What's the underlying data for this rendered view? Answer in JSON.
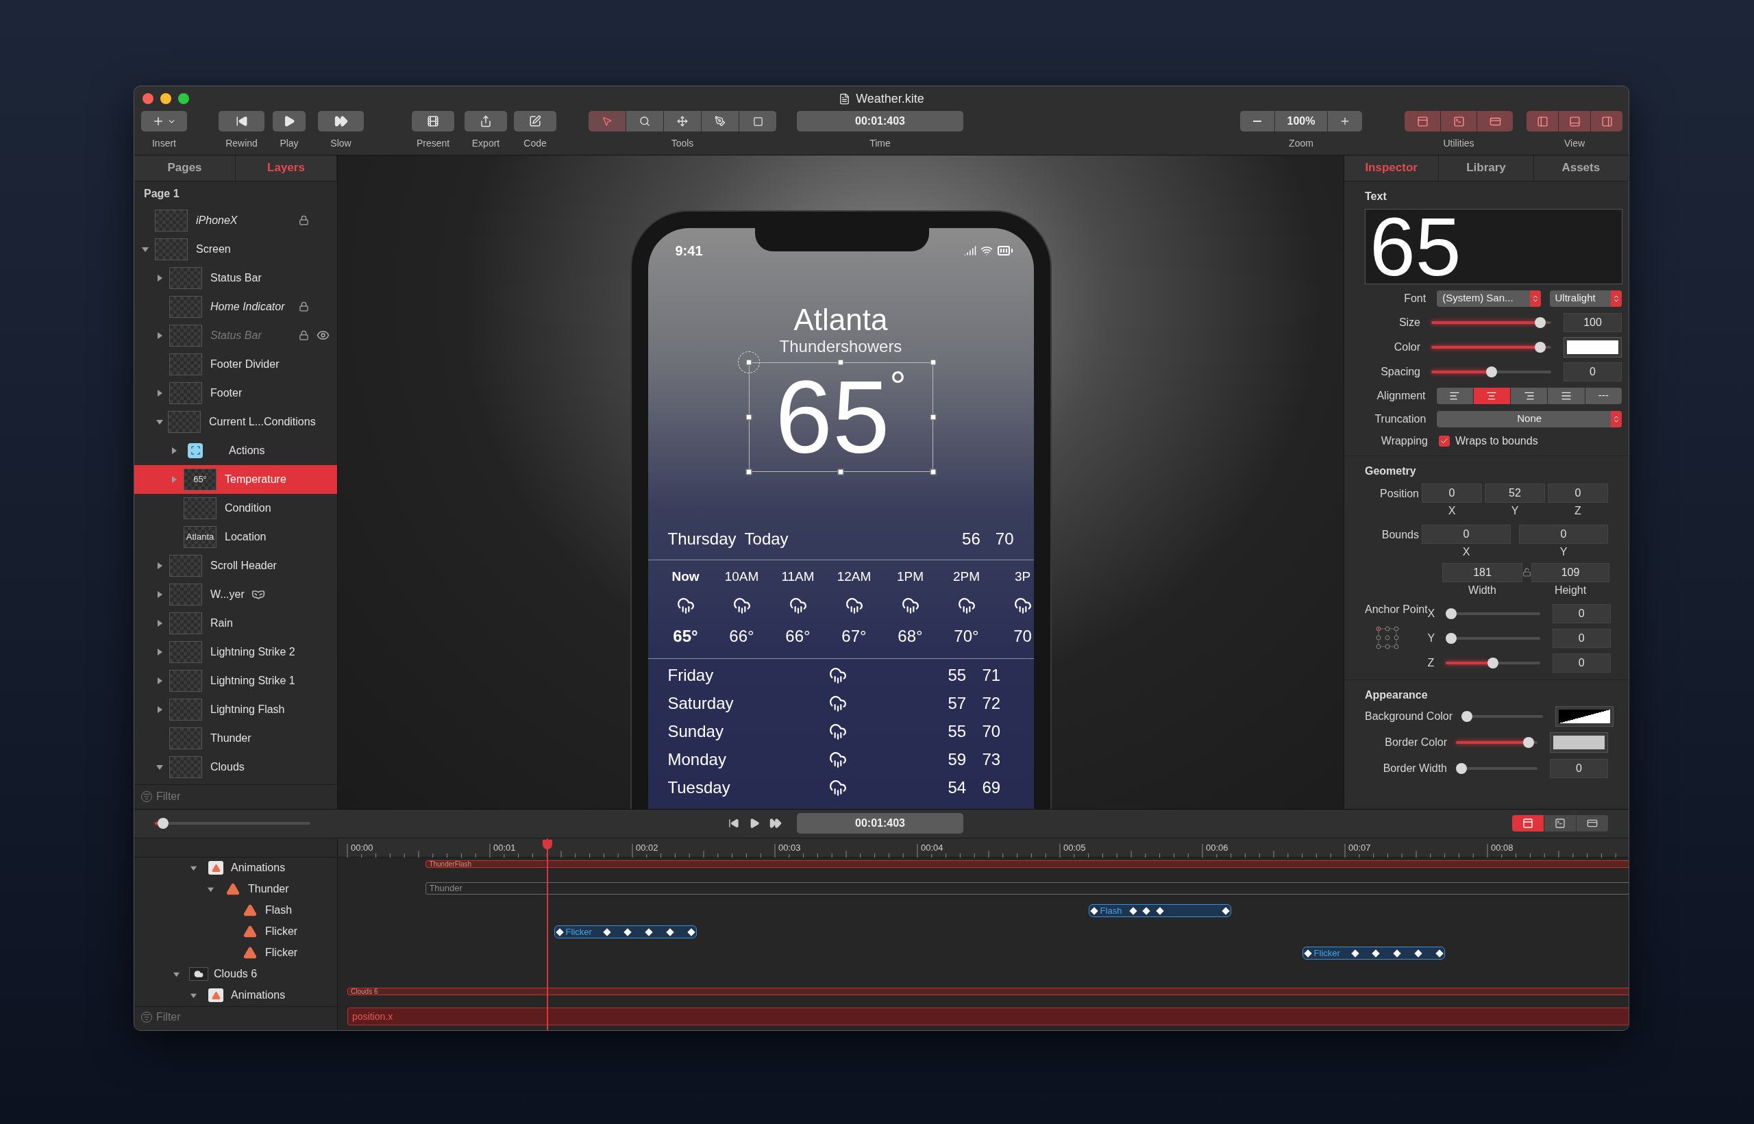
{
  "window": {
    "title": "Weather.kite"
  },
  "toolbar": {
    "insert": {
      "label": "Insert"
    },
    "transport": [
      {
        "label": "Rewind"
      },
      {
        "label": "Play"
      },
      {
        "label": "Slow"
      }
    ],
    "actions": [
      {
        "label": "Present"
      },
      {
        "label": "Export"
      },
      {
        "label": "Code"
      }
    ],
    "tools": {
      "label": "Tools",
      "items": [
        {
          "selected": true
        },
        {
          "selected": false
        },
        {
          "selected": false
        },
        {
          "selected": false
        },
        {
          "selected": false
        }
      ]
    },
    "time": {
      "label": "Time",
      "value": "00:01:403"
    },
    "zoom": {
      "label": "Zoom",
      "value": "100%"
    },
    "utilities": {
      "label": "Utilities",
      "items": [
        {
          "selected": true
        },
        {
          "selected": true
        },
        {
          "selected": true
        }
      ]
    },
    "view": {
      "label": "View",
      "items": [
        {
          "selected": true
        },
        {
          "selected": true
        },
        {
          "selected": true
        }
      ]
    }
  },
  "left_panel": {
    "tabs": [
      {
        "label": "Pages",
        "selected": false
      },
      {
        "label": "Layers",
        "selected": true
      }
    ],
    "page": "Page 1",
    "layers": [
      {
        "name": "iPhoneX",
        "kind": "instance",
        "selected": false,
        "locked": true
      },
      {
        "name": "Screen",
        "kind": "layer",
        "selected": false,
        "expanded": true,
        "children": [
          {
            "name": "Status Bar",
            "kind": "layer",
            "selected": false,
            "expanded": false
          },
          {
            "name": "Home Indicator",
            "kind": "instance",
            "selected": false,
            "locked": true
          },
          {
            "name": "Status Bar",
            "kind": "instance",
            "selected": false,
            "expanded": false,
            "locked": true,
            "hidden": true
          },
          {
            "name": "Footer Divider",
            "kind": "layer",
            "selected": false
          },
          {
            "name": "Footer",
            "kind": "layer",
            "selected": false,
            "expanded": false
          },
          {
            "name": "Current L...Conditions",
            "kind": "layer",
            "selected": false,
            "expanded": true,
            "children": [
              {
                "name": "Actions",
                "kind": "action",
                "selected": false,
                "expanded": false
              },
              {
                "name": "Temperature",
                "kind": "layer",
                "selected": true,
                "expanded": false,
                "thumbnail": "65°"
              },
              {
                "name": "Condition",
                "kind": "layer",
                "selected": false
              },
              {
                "name": "Location",
                "kind": "layer",
                "selected": false,
                "thumbnail": "Atlanta"
              }
            ]
          },
          {
            "name": "Scroll Header",
            "kind": "layer",
            "selected": false,
            "expanded": false
          },
          {
            "name": "W...yer",
            "kind": "layer",
            "selected": false,
            "expanded": false,
            "masked": true
          },
          {
            "name": "Rain",
            "kind": "layer",
            "selected": false,
            "expanded": false
          },
          {
            "name": "Lightning Strike 2",
            "kind": "layer",
            "selected": false,
            "expanded": false
          },
          {
            "name": "Lightning Strike 1",
            "kind": "layer",
            "selected": false,
            "expanded": false
          },
          {
            "name": "Lightning Flash",
            "kind": "layer",
            "selected": false,
            "expanded": false
          },
          {
            "name": "Thunder",
            "kind": "layer",
            "selected": false
          },
          {
            "name": "Clouds",
            "kind": "layer",
            "selected": false,
            "expanded": true
          }
        ]
      }
    ],
    "filter": {
      "placeholder": "Filter"
    }
  },
  "canvas": {
    "phone": {
      "status_time": "9:41",
      "city": "Atlanta",
      "condition": "Thundershowers",
      "temperature": "65",
      "degree": "°",
      "today": {
        "day": "Thursday",
        "label": "Today",
        "low": "56",
        "high": "70"
      },
      "hourly": [
        {
          "time": "Now",
          "temp": "65°",
          "current": true
        },
        {
          "time": "10AM",
          "temp": "66°",
          "current": false
        },
        {
          "time": "11AM",
          "temp": "66°",
          "current": false
        },
        {
          "time": "12AM",
          "temp": "67°",
          "current": false
        },
        {
          "time": "1PM",
          "temp": "68°",
          "current": false
        },
        {
          "time": "2PM",
          "temp": "70°",
          "current": false
        },
        {
          "time": "3P",
          "temp": "70",
          "current": false
        }
      ],
      "daily": [
        {
          "day": "Friday",
          "low": "55",
          "high": "71"
        },
        {
          "day": "Saturday",
          "low": "57",
          "high": "72"
        },
        {
          "day": "Sunday",
          "low": "55",
          "high": "70"
        },
        {
          "day": "Monday",
          "low": "59",
          "high": "73"
        },
        {
          "day": "Tuesday",
          "low": "54",
          "high": "69"
        }
      ]
    }
  },
  "inspector": {
    "tabs": [
      {
        "label": "Inspector",
        "selected": true
      },
      {
        "label": "Library",
        "selected": false
      },
      {
        "label": "Assets",
        "selected": false
      }
    ],
    "text": {
      "title": "Text",
      "preview": "65",
      "font": {
        "label": "Font",
        "family": "(System) San...",
        "weight": "Ultralight"
      },
      "rows": [
        {
          "label": "Size",
          "kind": "number",
          "level": 0.95,
          "value": "100"
        },
        {
          "label": "Color",
          "kind": "swatch",
          "level": 0.95,
          "color": "#ffffff"
        },
        {
          "label": "Spacing",
          "kind": "number",
          "level": 0.5,
          "value": "0"
        }
      ],
      "alignment": {
        "label": "Alignment",
        "options": [
          {
            "selected": false
          },
          {
            "selected": true
          },
          {
            "selected": false
          },
          {
            "selected": false
          },
          {
            "selected": false,
            "label": "---"
          }
        ]
      },
      "truncation": {
        "label": "Truncation",
        "value": "None"
      },
      "wrapping": {
        "label": "Wrapping",
        "checked": true,
        "text": "Wraps to bounds"
      }
    },
    "geometry": {
      "title": "Geometry",
      "position": {
        "label": "Position",
        "fields": [
          {
            "value": "0",
            "axis": "X"
          },
          {
            "value": "52",
            "axis": "Y"
          },
          {
            "value": "0",
            "axis": "Z"
          }
        ]
      },
      "bounds": {
        "label": "Bounds",
        "fields": [
          {
            "value": "0",
            "axis": "X"
          },
          {
            "value": "0",
            "axis": "Y"
          }
        ]
      },
      "size": {
        "locked": false,
        "fields": [
          {
            "value": "181",
            "axis": "Width"
          },
          {
            "value": "109",
            "axis": "Height"
          }
        ]
      },
      "anchor": {
        "label": "Anchor Point",
        "rows": [
          {
            "axis": "X",
            "level": 0,
            "value": "0"
          },
          {
            "axis": "Y",
            "level": 0,
            "value": "0"
          },
          {
            "axis": "Z",
            "level": 0.5,
            "value": "0"
          }
        ]
      }
    },
    "appearance": {
      "title": "Appearance",
      "rows": [
        {
          "label": "Background Color",
          "kind": "clear-swatch",
          "level": 0
        },
        {
          "label": "Border Color",
          "kind": "swatch",
          "level": 0.95,
          "color": "#c8c8c8"
        },
        {
          "label": "Border Width",
          "kind": "number",
          "level": 0,
          "value": "0"
        }
      ]
    }
  },
  "timeline": {
    "scrubber": {
      "level": 0.02
    },
    "time": "00:01:403",
    "toggles": [
      {
        "selected": true
      },
      {
        "selected": false
      },
      {
        "selected": false
      }
    ],
    "ruler": [
      "00:00",
      "00:01",
      "00:02",
      "00:03",
      "00:04",
      "00:05",
      "00:06",
      "00:07",
      "00:08"
    ],
    "tracks": [
      {
        "name": "Animations",
        "kind": "animations",
        "expanded": true,
        "clip": {
          "kind": "span",
          "label": "ThunderFlash"
        },
        "children": [
          {
            "name": "Thunder",
            "kind": "animation",
            "expanded": true,
            "clip": {
              "kind": "muted",
              "label": "Thunder"
            },
            "children": [
              {
                "name": "Flash",
                "kind": "animation",
                "clip": {
                  "kind": "keyframes",
                  "label": "Flash"
                }
              },
              {
                "name": "Flicker",
                "kind": "animation",
                "clip": {
                  "kind": "keyframes",
                  "label": "Flicker"
                }
              },
              {
                "name": "Flicker",
                "kind": "animation",
                "clip": {
                  "kind": "keyframes",
                  "label": "Flicker"
                }
              }
            ]
          }
        ]
      },
      {
        "name": "Clouds 6",
        "kind": "layer",
        "expanded": true,
        "children": [
          {
            "name": "Animations",
            "kind": "animations",
            "expanded": true,
            "clip": {
              "kind": "span",
              "label": "Clouds 6"
            }
          }
        ]
      }
    ],
    "extra_clip": {
      "kind": "bar",
      "label": "position.x"
    },
    "filter": {
      "placeholder": "Filter"
    }
  }
}
